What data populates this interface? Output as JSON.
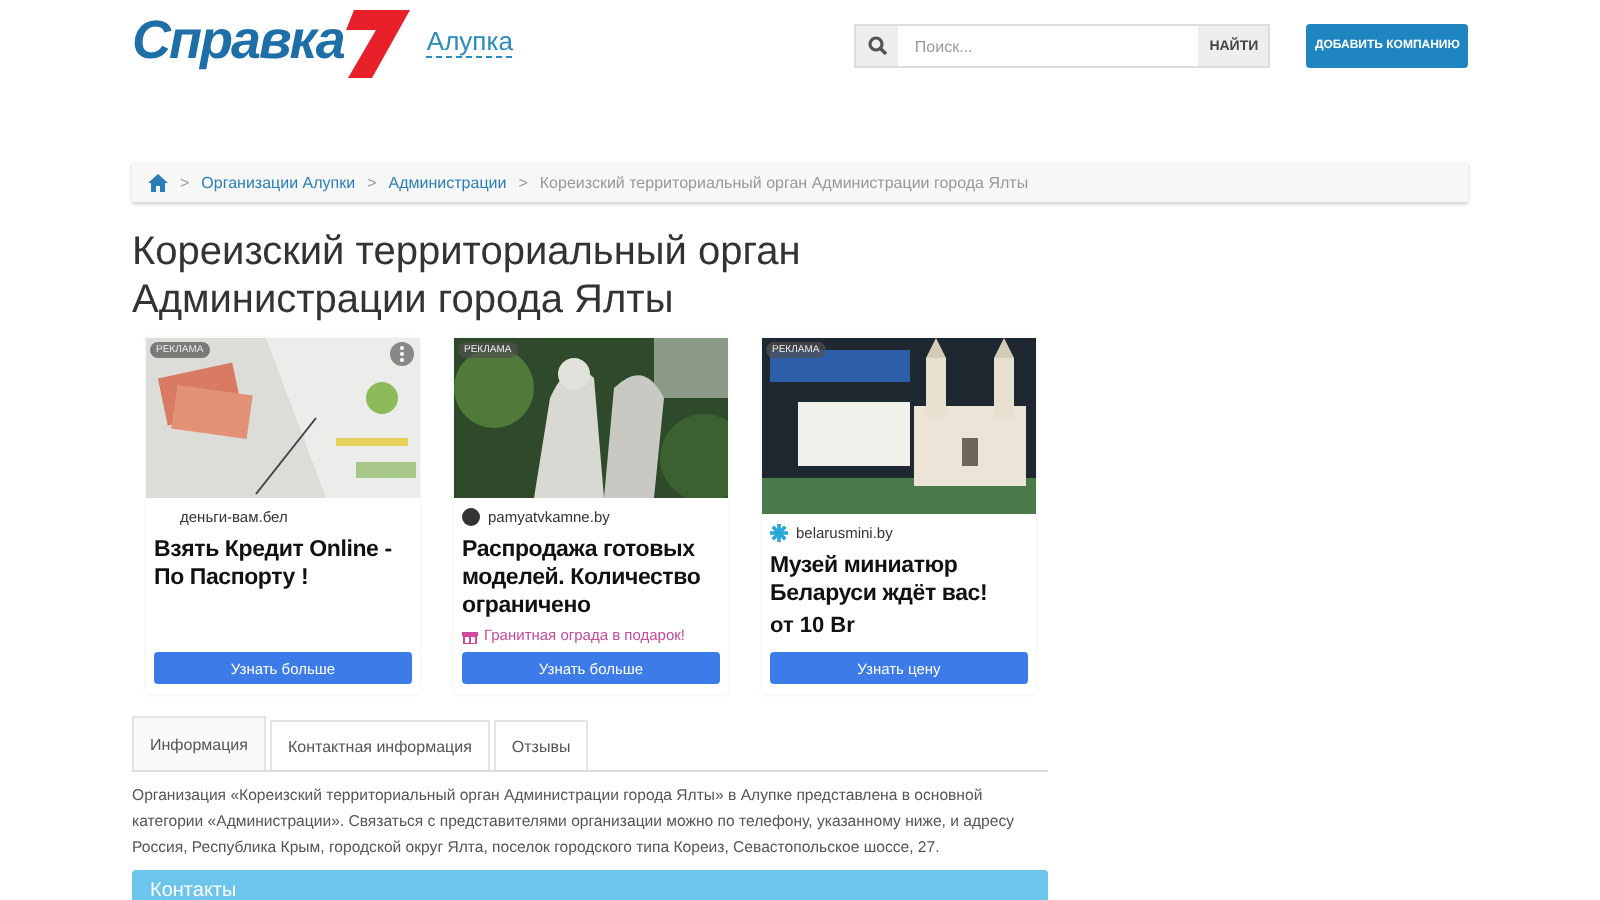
{
  "header": {
    "logo": "Справка",
    "city": "Алупка",
    "search": {
      "placeholder": "Поиск...",
      "button": "НАЙТИ"
    },
    "add_button": "ДОБАВИТЬ КОМПАНИЮ"
  },
  "breadcrumbs": [
    {
      "separator": ">",
      "label": "Организации Алупки",
      "kind": "link"
    },
    {
      "separator": ">",
      "label": "Администрации",
      "kind": "link"
    },
    {
      "separator": ">",
      "label": "Кореизский территориальный орган Администрации города Ялты",
      "kind": "current"
    }
  ],
  "title": "Кореизский территориальный орган Администрации города Ялты",
  "ads": [
    {
      "badge": "РЕКЛАМА",
      "domain": "деньги-вам.бел",
      "headline": "Взять Кредит Online - По Паспорту !",
      "button": "Узнать больше"
    },
    {
      "badge": "РЕКЛАМА",
      "domain": "pamyatvkamne.by",
      "headline": "Распродажа готовых моделей. Количество ограничено",
      "extra": {
        "kind": "promo",
        "text": "Гранитная ограда в подарок!"
      },
      "button": "Узнать больше"
    },
    {
      "badge": "РЕКЛАМА",
      "domain": "belarusmini.by",
      "headline": "Музей миниатюр Беларуси ждёт вас!",
      "extra": {
        "kind": "price",
        "text": "от 10 Br"
      },
      "button": "Узнать цену"
    }
  ],
  "tabs": [
    {
      "label": "Информация",
      "selected": true
    },
    {
      "label": "Контактная информация",
      "selected": false
    },
    {
      "label": "Отзывы",
      "selected": false
    }
  ],
  "description": "Организация «Кореизский территориальный орган Администрации города Ялты» в Алупке представлена в основной категории «Администрации». Связаться с представителями организации можно по телефону, указанному ниже, и адресу Россия, Республика Крым, городской округ Ялта, поселок городского типа Кореиз, Севастопольское шоссе, 27.",
  "contacts_heading": "Контакты"
}
